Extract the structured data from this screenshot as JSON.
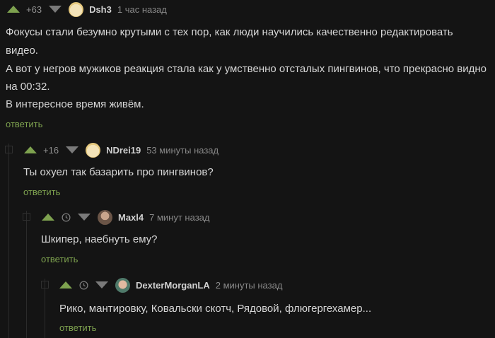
{
  "colors": {
    "background": "#141414",
    "accent": "#7ea24f",
    "text": "#d6d6d6",
    "muted": "#8a8a8a"
  },
  "comments": [
    {
      "rating": "+63",
      "nick": "Dsh3",
      "time": "1 час назад",
      "lines": [
        "Фокусы стали безумно крутыми с тех пор, как люди научились качественно редактировать",
        "видео.",
        "А вот у негров мужиков реакция стала как у умственно отсталых пингвинов, что прекрасно видно",
        "на 00:32.",
        "В интересное время живём."
      ],
      "reply": "ответить"
    },
    {
      "rating": "+16",
      "nick": "NDrei19",
      "time": "53 минуты назад",
      "lines": [
        "Ты охуел так базарить про пингвинов?"
      ],
      "reply": "ответить"
    },
    {
      "nick": "Maxl4",
      "time": "7 минут назад",
      "lines": [
        "Шкипер, наебнуть ему?"
      ],
      "reply": "ответить"
    },
    {
      "nick": "DexterMorganLA",
      "time": "2 минуты назад",
      "lines": [
        "Рико, мантировку, Ковальски скотч, Рядовой, флюгергехамер..."
      ],
      "reply": "ответить"
    }
  ]
}
